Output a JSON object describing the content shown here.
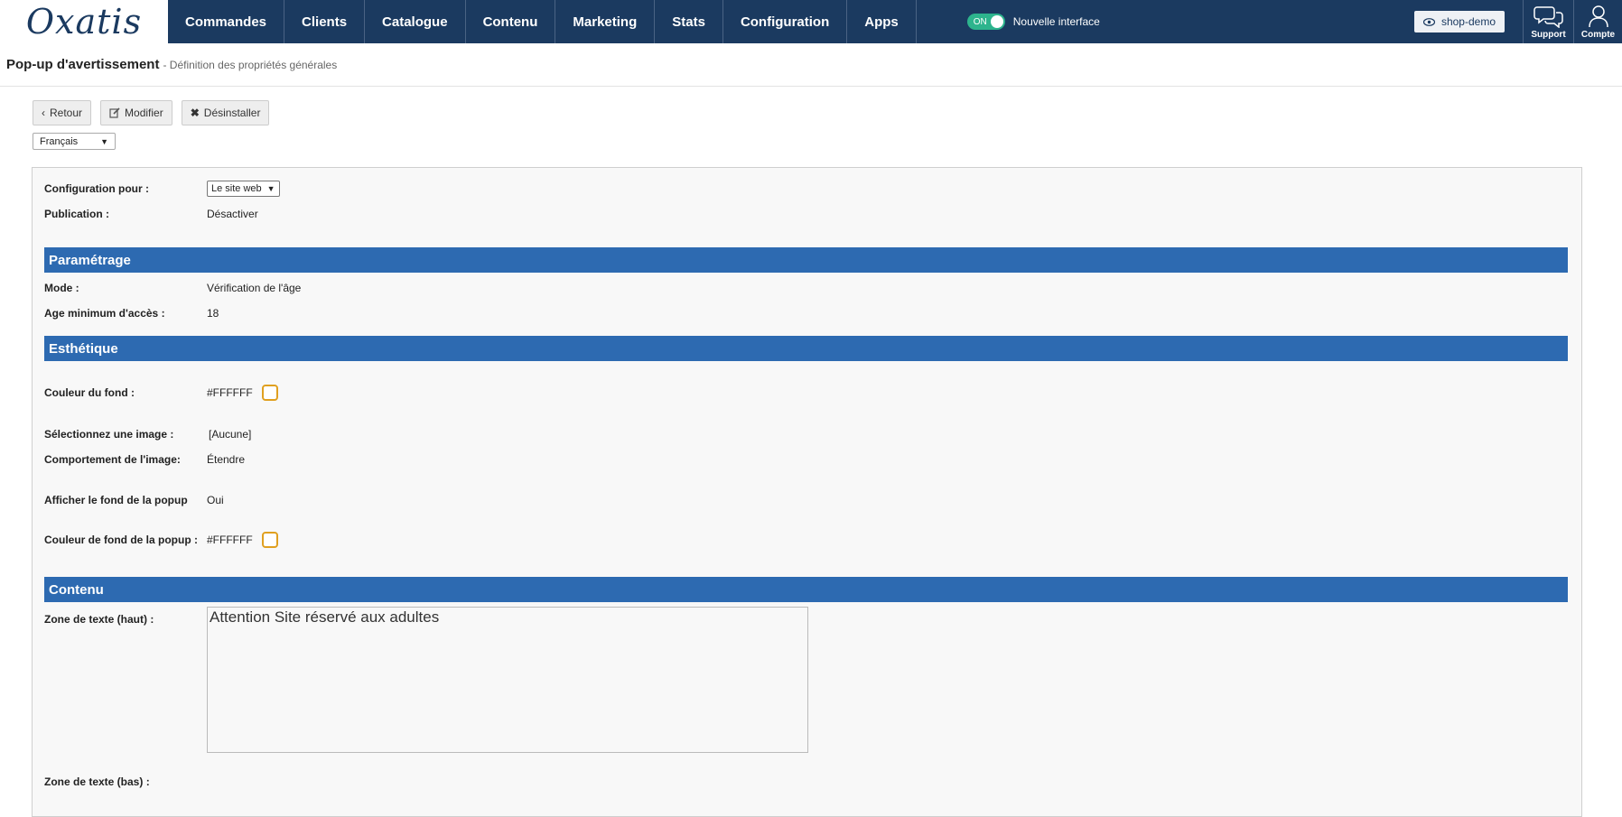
{
  "brand": {
    "logo_text": "Oxatis"
  },
  "nav": {
    "items": [
      {
        "label": "Commandes"
      },
      {
        "label": "Clients"
      },
      {
        "label": "Catalogue"
      },
      {
        "label": "Contenu"
      },
      {
        "label": "Marketing"
      },
      {
        "label": "Stats"
      },
      {
        "label": "Configuration"
      },
      {
        "label": "Apps"
      }
    ]
  },
  "toggle": {
    "state_label": "ON",
    "text": "Nouvelle interface",
    "on": true,
    "color": "#2db48d"
  },
  "topbar_right": {
    "shop_label": "shop-demo",
    "support_label": "Support",
    "account_label": "Compte"
  },
  "header": {
    "title": "Pop-up d'avertissement",
    "subtitle": "- Définition des propriétés générales"
  },
  "toolbar": {
    "back_label": "Retour",
    "edit_label": "Modifier",
    "uninstall_label": "Désinstaller"
  },
  "language": {
    "selected": "Français"
  },
  "general": {
    "config_label": "Configuration pour :",
    "config_value": "Le site web",
    "publication_label": "Publication :",
    "publication_value": "Désactiver"
  },
  "sections": {
    "parametrage": "Paramétrage",
    "esthetique": "Esthétique",
    "contenu": "Contenu"
  },
  "parametrage": {
    "mode_label": "Mode :",
    "mode_value": "Vérification de l'âge",
    "age_label": "Age minimum d'accès :",
    "age_value": "18"
  },
  "esthetique": {
    "bg_color_label": "Couleur du fond :",
    "bg_color_value": "#FFFFFF",
    "image_label": "Sélectionnez une image :",
    "image_value": "[Aucune]",
    "image_behavior_label": "Comportement de l'image:",
    "image_behavior_value": "Étendre",
    "show_bg_label": "Afficher le fond de la popup",
    "show_bg_value": "Oui",
    "popup_bg_label": "Couleur de fond de la popup :",
    "popup_bg_value": "#FFFFFF"
  },
  "contenu": {
    "top_text_label": "Zone de texte (haut) :",
    "top_text_value": "Attention Site réservé aux adultes",
    "bottom_text_label": "Zone de texte (bas) :"
  },
  "colors": {
    "topbar": "#1b3a60",
    "section": "#2d6ab1",
    "swatch_border": "#e0a020"
  }
}
